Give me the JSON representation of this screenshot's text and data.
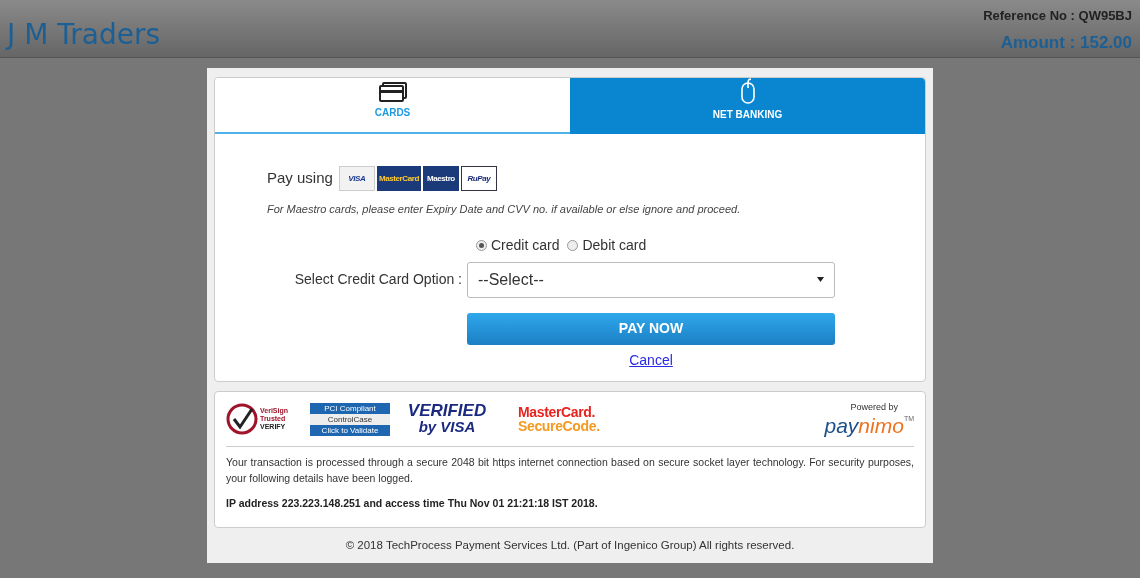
{
  "header": {
    "merchant": "J M Traders",
    "reference": "Reference No : QW95BJ",
    "amount": "Amount : 152.00"
  },
  "tabs": [
    {
      "label": "CARDS",
      "selected": true
    },
    {
      "label": "NET BANKING",
      "selected": false
    }
  ],
  "pay_using": {
    "label": "Pay using",
    "logos": [
      {
        "kind": "visa",
        "text": "VISA"
      },
      {
        "kind": "mastercard",
        "text": "MasterCard"
      },
      {
        "kind": "maestro",
        "text": "Maestro"
      },
      {
        "kind": "rupay",
        "text": "RuPay"
      }
    ]
  },
  "note": "For Maestro cards, please enter Expiry Date and CVV no. if available or else ignore and proceed.",
  "card_types": [
    {
      "label": "Credit card",
      "selected": true
    },
    {
      "label": "Debit card",
      "selected": false
    }
  ],
  "option": {
    "label": "Select Credit Card Option :",
    "value": "--Select--"
  },
  "pay_button": "PAY NOW",
  "cancel_link": "Cancel",
  "seals": [
    {
      "kind": "verisign",
      "lines": [
        "VeriSign",
        "Trusted",
        "VERIFY"
      ]
    },
    {
      "kind": "pci",
      "lines": [
        "PCI Compliant",
        "ControlCase",
        "Click to Validate"
      ]
    },
    {
      "kind": "vbv",
      "lines": [
        "VERIFIED",
        "by VISA"
      ]
    },
    {
      "kind": "securecode",
      "lines": [
        "MasterCard.",
        "SecureCode."
      ]
    }
  ],
  "powered": {
    "label": "Powered by",
    "brand_a": "pay",
    "brand_b": "nimo",
    "tm": "TM"
  },
  "security_text": "Your transaction is processed through a secure 2048 bit https internet connection based on secure socket layer technology. For security purposes, your following details have been logged.",
  "ip_text": "IP address 223.223.148.251 and access time Thu Nov 01 21:21:18 IST 2018.",
  "copyright": "© 2018 TechProcess Payment Services Ltd. (Part of Ingenico Group) All rights reserved."
}
